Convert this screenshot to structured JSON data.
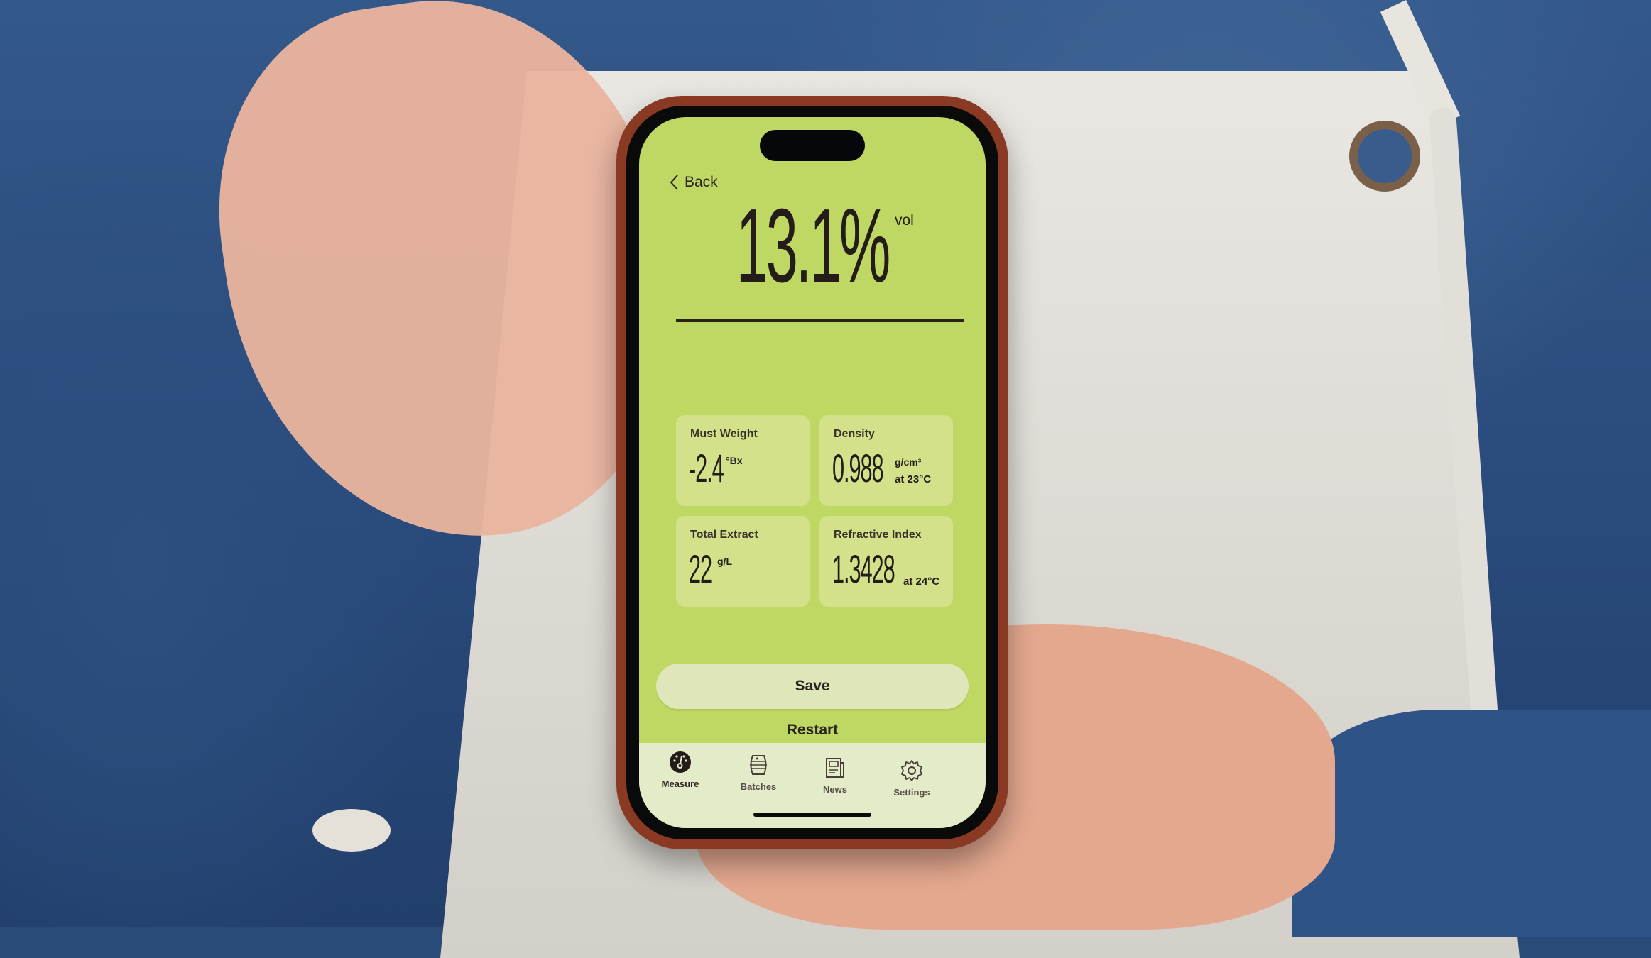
{
  "nav": {
    "back_label": "Back"
  },
  "result": {
    "value": "13.1%",
    "unit": "vol"
  },
  "cards": [
    {
      "label": "Must Weight",
      "value": "-2.4",
      "unit": "°Bx",
      "note": ""
    },
    {
      "label": "Density",
      "value": "0.988",
      "unit": "g/cm³",
      "note": "at 23°C"
    },
    {
      "label": "Total Extract",
      "value": "22",
      "unit": "g/L",
      "note": ""
    },
    {
      "label": "Refractive Index",
      "value": "1.3428",
      "unit": "",
      "note": "at 24°C"
    }
  ],
  "actions": {
    "save_label": "Save",
    "restart_label": "Restart"
  },
  "tabbar": {
    "items": [
      {
        "label": "Measure",
        "icon": "gauge-icon",
        "active": true
      },
      {
        "label": "Batches",
        "icon": "barrel-icon",
        "active": false
      },
      {
        "label": "News",
        "icon": "newspaper-icon",
        "active": false
      },
      {
        "label": "Settings",
        "icon": "gear-icon",
        "active": false
      }
    ]
  },
  "colors": {
    "screen_bg": "#bfd863",
    "card_bg": "#d3e28a",
    "tabbar_bg": "#e4ebc8",
    "text": "#241c18",
    "case": "#8a3a22"
  }
}
